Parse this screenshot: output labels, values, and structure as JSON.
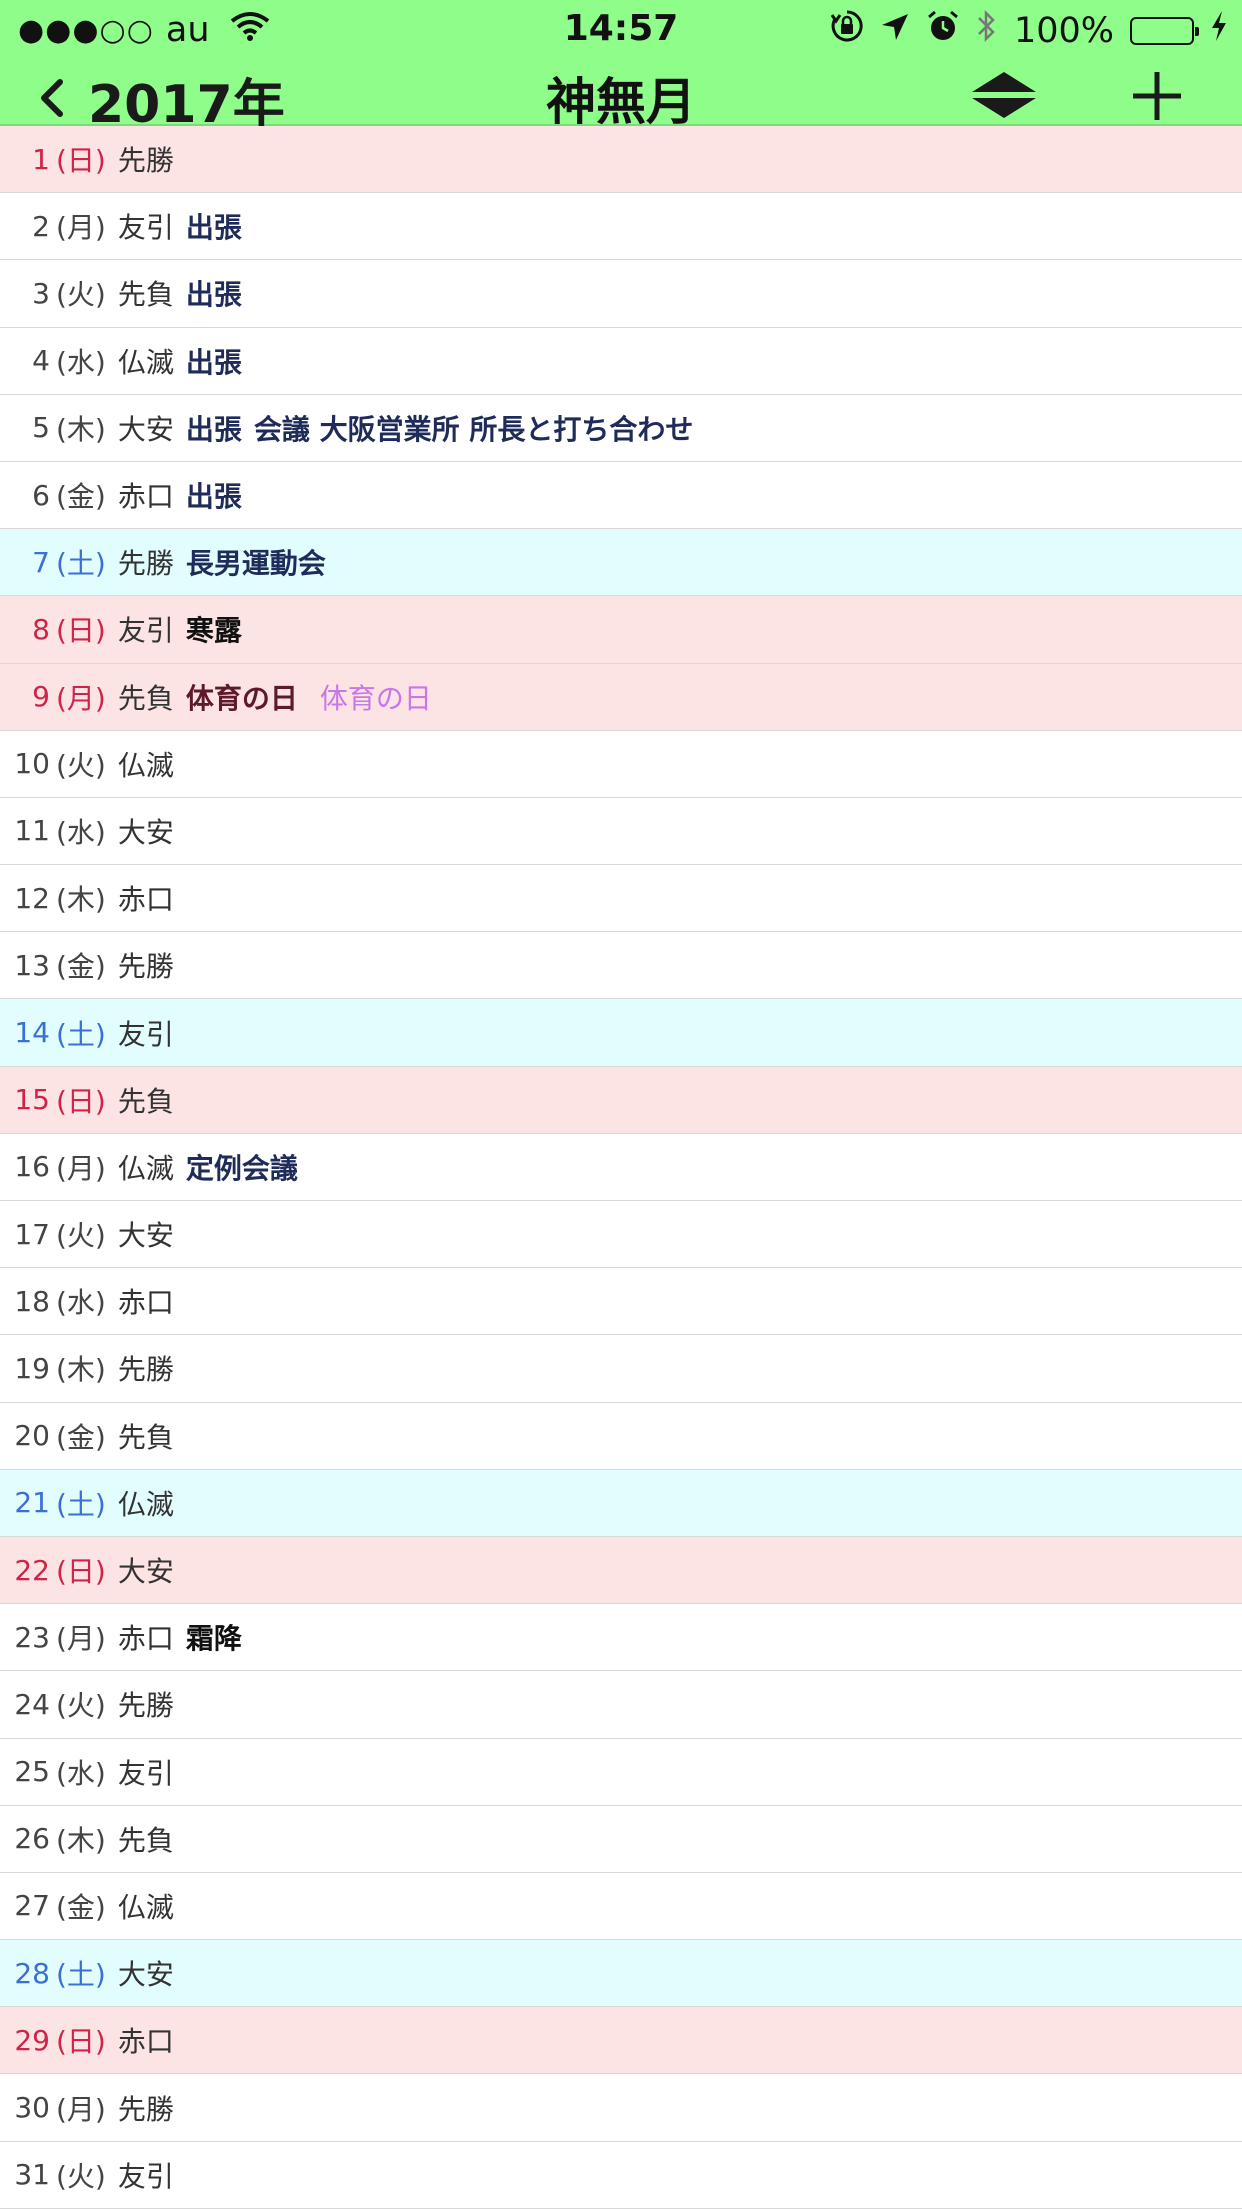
{
  "status_bar": {
    "signal_dots": "●●●○○",
    "carrier": "au",
    "time": "14:57",
    "battery": "100%",
    "icons": [
      "wifi-icon",
      "orientation-lock-icon",
      "location-icon",
      "alarm-icon",
      "bluetooth-icon",
      "charging-icon"
    ]
  },
  "nav": {
    "back_label": "2017年",
    "title": "神無月"
  },
  "colors": {
    "header_bg": "#8efd8a",
    "sunday_bg": "#fde4e4",
    "saturday_bg": "#e2fdfd",
    "sunday_text": "#cf2447",
    "saturday_text": "#3a6fd6",
    "event_text": "#1f2b58",
    "holiday_text": "#c877e8"
  },
  "days": [
    {
      "day": "1",
      "weekday": "(日)",
      "rokuyo": "先勝",
      "type": "sun",
      "events": []
    },
    {
      "day": "2",
      "weekday": "(月)",
      "rokuyo": "友引",
      "type": "weekday",
      "events": [
        {
          "text": "出張",
          "style": "dark"
        }
      ]
    },
    {
      "day": "3",
      "weekday": "(火)",
      "rokuyo": "先負",
      "type": "weekday",
      "events": [
        {
          "text": "出張",
          "style": "dark"
        }
      ]
    },
    {
      "day": "4",
      "weekday": "(水)",
      "rokuyo": "仏滅",
      "type": "weekday",
      "events": [
        {
          "text": "出張",
          "style": "dark"
        }
      ]
    },
    {
      "day": "5",
      "weekday": "(木)",
      "rokuyo": "大安",
      "type": "weekday",
      "events": [
        {
          "text": "出張",
          "style": "dark"
        },
        {
          "text": "会議 大阪営業所 所長と打ち合わせ",
          "style": "dark"
        }
      ]
    },
    {
      "day": "6",
      "weekday": "(金)",
      "rokuyo": "赤口",
      "type": "weekday",
      "events": [
        {
          "text": "出張",
          "style": "dark"
        }
      ]
    },
    {
      "day": "7",
      "weekday": "(土)",
      "rokuyo": "先勝",
      "type": "sat",
      "events": [
        {
          "text": "長男運動会",
          "style": "dark"
        }
      ]
    },
    {
      "day": "8",
      "weekday": "(日)",
      "rokuyo": "友引",
      "type": "sun",
      "events": [
        {
          "text": "寒露",
          "style": "black"
        }
      ]
    },
    {
      "day": "9",
      "weekday": "(月)",
      "rokuyo": "先負",
      "type": "sun",
      "events": [
        {
          "text": "体育の日",
          "style": "maroon"
        },
        {
          "text": "体育の日",
          "style": "violet"
        }
      ]
    },
    {
      "day": "10",
      "weekday": "(火)",
      "rokuyo": "仏滅",
      "type": "weekday",
      "events": []
    },
    {
      "day": "11",
      "weekday": "(水)",
      "rokuyo": "大安",
      "type": "weekday",
      "events": []
    },
    {
      "day": "12",
      "weekday": "(木)",
      "rokuyo": "赤口",
      "type": "weekday",
      "events": []
    },
    {
      "day": "13",
      "weekday": "(金)",
      "rokuyo": "先勝",
      "type": "weekday",
      "events": []
    },
    {
      "day": "14",
      "weekday": "(土)",
      "rokuyo": "友引",
      "type": "sat",
      "events": []
    },
    {
      "day": "15",
      "weekday": "(日)",
      "rokuyo": "先負",
      "type": "sun",
      "events": []
    },
    {
      "day": "16",
      "weekday": "(月)",
      "rokuyo": "仏滅",
      "type": "weekday",
      "events": [
        {
          "text": "定例会議",
          "style": "dark"
        }
      ]
    },
    {
      "day": "17",
      "weekday": "(火)",
      "rokuyo": "大安",
      "type": "weekday",
      "events": []
    },
    {
      "day": "18",
      "weekday": "(水)",
      "rokuyo": "赤口",
      "type": "weekday",
      "events": []
    },
    {
      "day": "19",
      "weekday": "(木)",
      "rokuyo": "先勝",
      "type": "weekday",
      "events": []
    },
    {
      "day": "20",
      "weekday": "(金)",
      "rokuyo": "先負",
      "type": "weekday",
      "events": []
    },
    {
      "day": "21",
      "weekday": "(土)",
      "rokuyo": "仏滅",
      "type": "sat",
      "events": []
    },
    {
      "day": "22",
      "weekday": "(日)",
      "rokuyo": "大安",
      "type": "sun",
      "events": []
    },
    {
      "day": "23",
      "weekday": "(月)",
      "rokuyo": "赤口",
      "type": "weekday",
      "events": [
        {
          "text": "霜降",
          "style": "black"
        }
      ]
    },
    {
      "day": "24",
      "weekday": "(火)",
      "rokuyo": "先勝",
      "type": "weekday",
      "events": []
    },
    {
      "day": "25",
      "weekday": "(水)",
      "rokuyo": "友引",
      "type": "weekday",
      "events": []
    },
    {
      "day": "26",
      "weekday": "(木)",
      "rokuyo": "先負",
      "type": "weekday",
      "events": []
    },
    {
      "day": "27",
      "weekday": "(金)",
      "rokuyo": "仏滅",
      "type": "weekday",
      "events": []
    },
    {
      "day": "28",
      "weekday": "(土)",
      "rokuyo": "大安",
      "type": "sat",
      "events": []
    },
    {
      "day": "29",
      "weekday": "(日)",
      "rokuyo": "赤口",
      "type": "sun",
      "events": []
    },
    {
      "day": "30",
      "weekday": "(月)",
      "rokuyo": "先勝",
      "type": "weekday",
      "events": []
    },
    {
      "day": "31",
      "weekday": "(火)",
      "rokuyo": "友引",
      "type": "weekday",
      "events": []
    }
  ]
}
